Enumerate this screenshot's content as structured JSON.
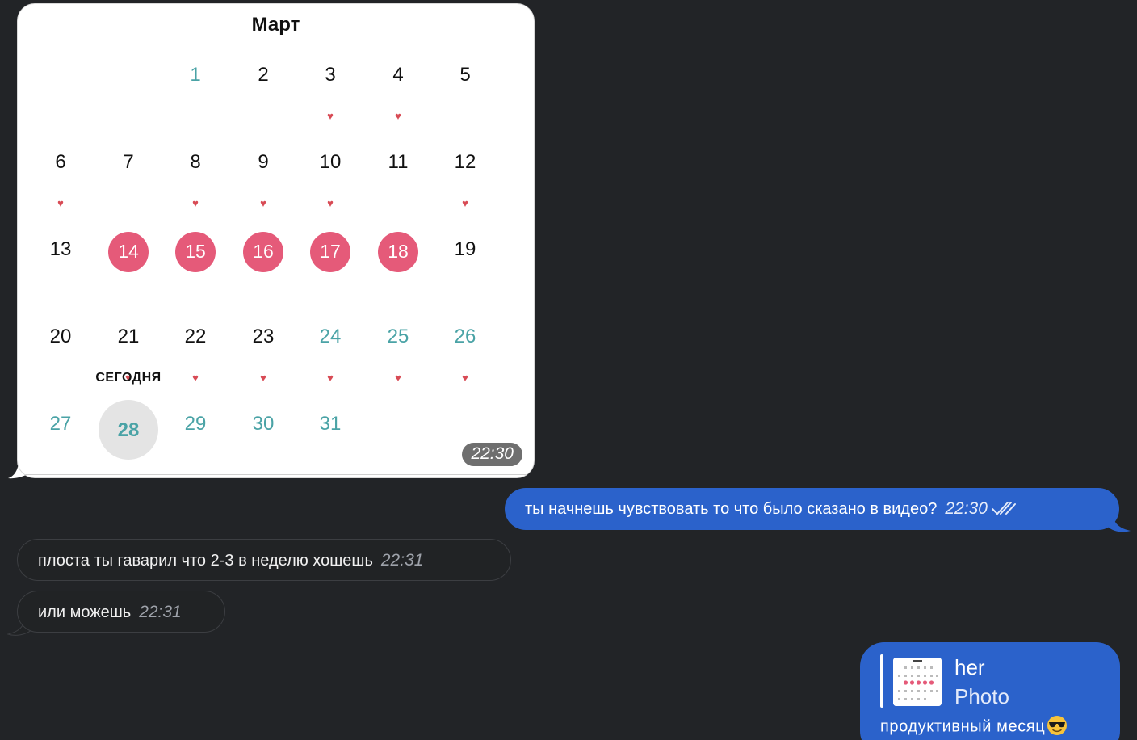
{
  "calendar": {
    "month": "Март",
    "today_label": "СЕГОДНЯ",
    "photo_time": "22:30",
    "weeks": [
      [
        null,
        null,
        {
          "day": "1",
          "style": "teal",
          "heart": false
        },
        {
          "day": "2",
          "style": "normal",
          "heart": false
        },
        {
          "day": "3",
          "style": "normal",
          "heart": true
        },
        {
          "day": "4",
          "style": "normal",
          "heart": true
        },
        {
          "day": "5",
          "style": "normal",
          "heart": false
        }
      ],
      [
        {
          "day": "6",
          "style": "normal",
          "heart": true
        },
        {
          "day": "7",
          "style": "normal",
          "heart": false
        },
        {
          "day": "8",
          "style": "normal",
          "heart": true
        },
        {
          "day": "9",
          "style": "normal",
          "heart": true
        },
        {
          "day": "10",
          "style": "normal",
          "heart": true
        },
        {
          "day": "11",
          "style": "normal",
          "heart": false
        },
        {
          "day": "12",
          "style": "normal",
          "heart": true
        }
      ],
      [
        {
          "day": "13",
          "style": "normal",
          "heart": false
        },
        {
          "day": "14",
          "style": "period",
          "heart": false
        },
        {
          "day": "15",
          "style": "period",
          "heart": false
        },
        {
          "day": "16",
          "style": "period",
          "heart": false
        },
        {
          "day": "17",
          "style": "period",
          "heart": false
        },
        {
          "day": "18",
          "style": "period",
          "heart": false
        },
        {
          "day": "19",
          "style": "normal",
          "heart": false
        }
      ],
      [
        {
          "day": "20",
          "style": "normal",
          "heart": false
        },
        {
          "day": "21",
          "style": "normal",
          "heart": true
        },
        {
          "day": "22",
          "style": "normal",
          "heart": true
        },
        {
          "day": "23",
          "style": "normal",
          "heart": true
        },
        {
          "day": "24",
          "style": "teal",
          "heart": true
        },
        {
          "day": "25",
          "style": "teal",
          "heart": true
        },
        {
          "day": "26",
          "style": "teal",
          "heart": true
        }
      ],
      [
        {
          "day": "27",
          "style": "teal",
          "heart": false
        },
        {
          "day": "28",
          "style": "today",
          "heart": false
        },
        {
          "day": "29",
          "style": "teal",
          "heart": false
        },
        {
          "day": "30",
          "style": "teal",
          "heart": false
        },
        {
          "day": "31",
          "style": "teal",
          "heart": false
        },
        null,
        null
      ]
    ],
    "heart_glyph": "♥"
  },
  "messages": {
    "out1": {
      "text": "ты начнешь чувствовать то что было сказано в видео?",
      "time": "22:30"
    },
    "in1": {
      "text": "плоста ты гаварил что 2-3 в неделю хошешь",
      "time": "22:31"
    },
    "in2": {
      "text": "или можешь",
      "time": "22:31"
    }
  },
  "reply": {
    "name": "her",
    "kind": "Photo",
    "text": "продуктивный месяц"
  },
  "colors": {
    "background": "#222427",
    "outgoing": "#2b62cb",
    "incoming": "#212325",
    "period": "#e55a79",
    "teal": "#4aa3a6",
    "heart": "#d84b55"
  }
}
